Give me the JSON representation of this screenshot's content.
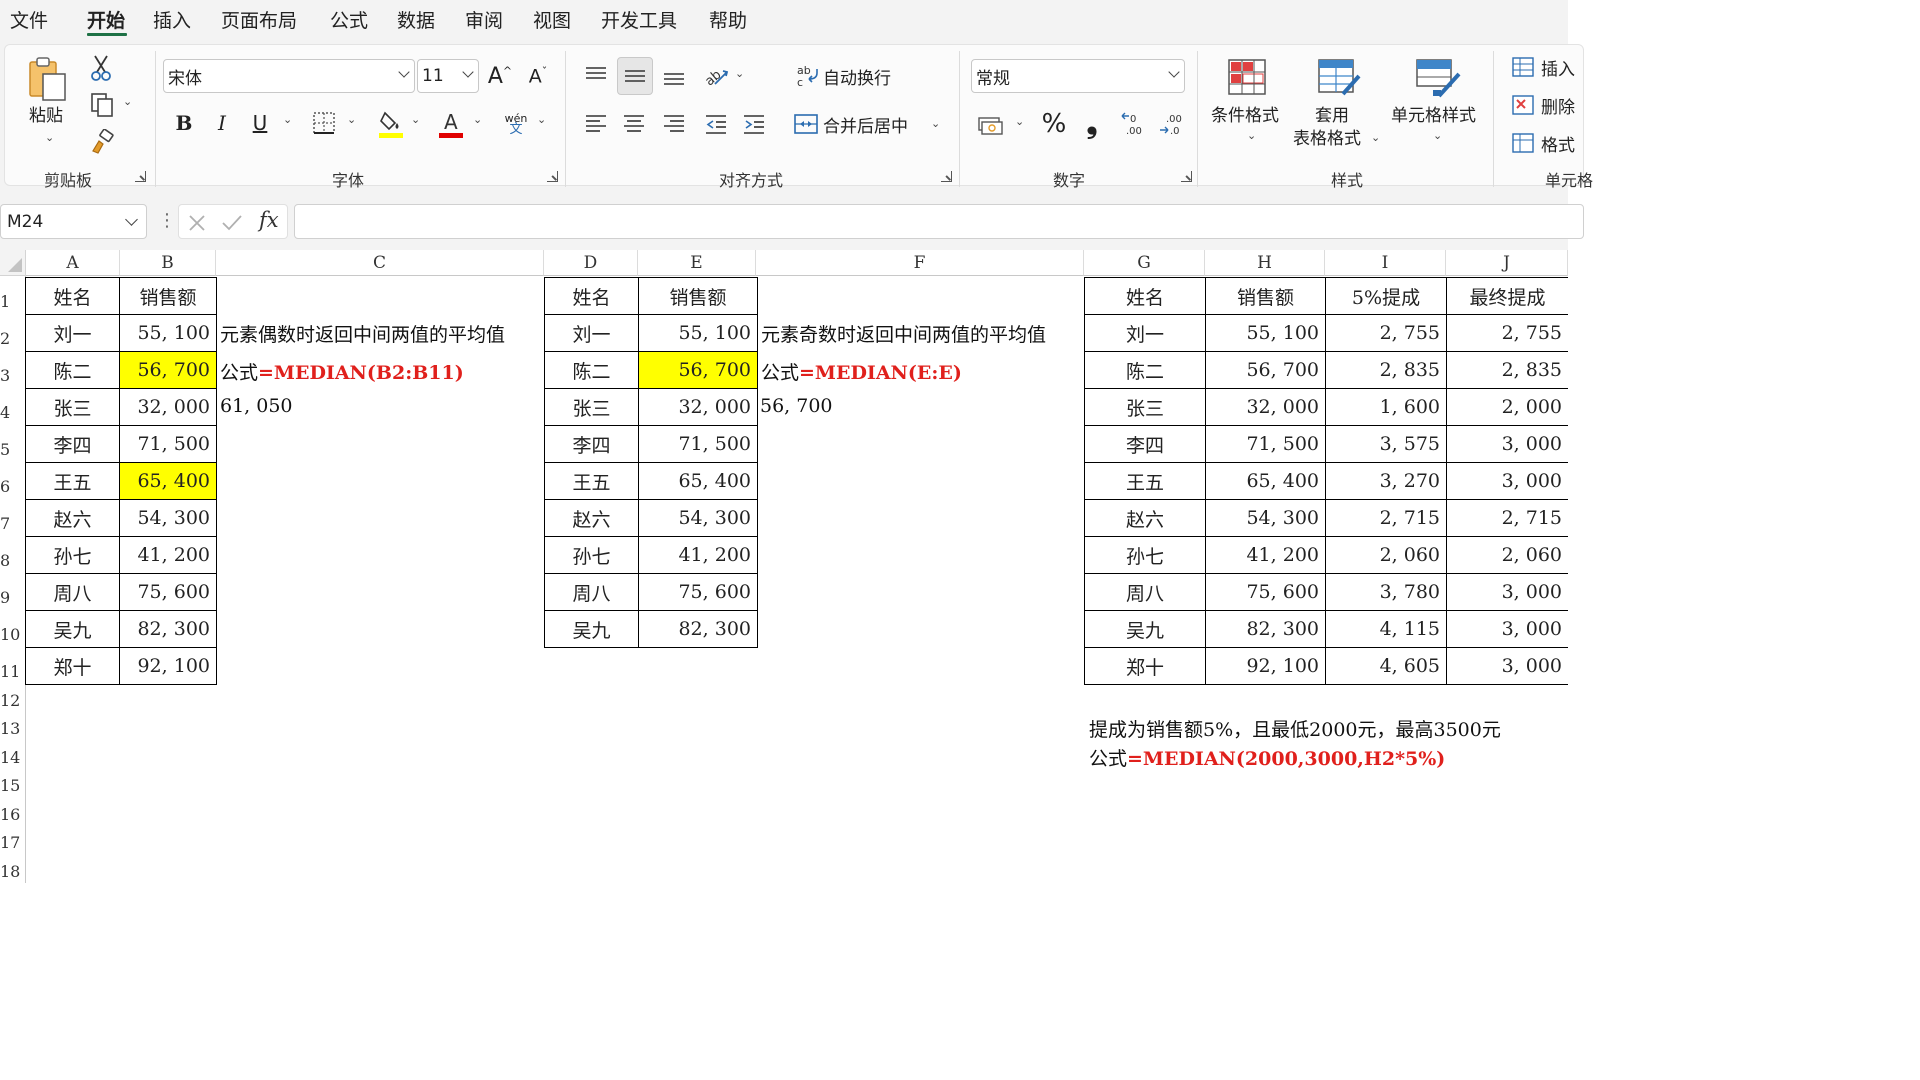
{
  "menu": [
    "文件",
    "开始",
    "插入",
    "页面布局",
    "公式",
    "数据",
    "审阅",
    "视图",
    "开发工具",
    "帮助"
  ],
  "menu_active": "开始",
  "ribbon": {
    "clipboard": {
      "paste": "粘贴",
      "label": "剪贴板"
    },
    "font": {
      "name": "宋体",
      "size": "11",
      "bold": "B",
      "italic": "I",
      "underline": "U",
      "phonetic": "wén",
      "phonetic_sub": "文",
      "label": "字体"
    },
    "alignment": {
      "wrap": "自动换行",
      "merge": "合并后居中",
      "label": "对齐方式"
    },
    "number": {
      "format": "常规",
      "percent": "%",
      "comma": "❟",
      "label": "数字"
    },
    "styles": {
      "conditional": "条件格式",
      "table_line1": "套用",
      "table_line2": "表格格式",
      "cell_styles": "单元格样式",
      "label": "样式"
    },
    "cells": {
      "insert": "插入",
      "delete": "删除",
      "format": "格式",
      "label": "单元格"
    }
  },
  "formula_bar": {
    "name_box": "M24",
    "fx": "fx",
    "value": ""
  },
  "columns": [
    "A",
    "B",
    "C",
    "D",
    "E",
    "F",
    "G",
    "H",
    "I",
    "J"
  ],
  "rows": [
    "1",
    "2",
    "3",
    "4",
    "5",
    "6",
    "7",
    "8",
    "9",
    "10",
    "11",
    "12",
    "13",
    "14",
    "15",
    "16",
    "17",
    "18"
  ],
  "table1": {
    "headers": [
      "姓名",
      "销售额"
    ],
    "rows": [
      [
        "刘一",
        "55, 100"
      ],
      [
        "陈二",
        "56, 700"
      ],
      [
        "张三",
        "32, 000"
      ],
      [
        "李四",
        "71, 500"
      ],
      [
        "王五",
        "65, 400"
      ],
      [
        "赵六",
        "54, 300"
      ],
      [
        "孙七",
        "41, 200"
      ],
      [
        "周八",
        "75, 600"
      ],
      [
        "吴九",
        "82, 300"
      ],
      [
        "郑十",
        "92, 100"
      ]
    ],
    "highlight_rows": [
      1,
      4
    ],
    "highlight_color": "#ffff00"
  },
  "note1": {
    "text": "元素偶数时返回中间两值的平均值",
    "formula_prefix": "公式",
    "formula": "=MEDIAN(B2:B11)",
    "result": "61, 050"
  },
  "table2": {
    "headers": [
      "姓名",
      "销售额"
    ],
    "rows": [
      [
        "刘一",
        "55, 100"
      ],
      [
        "陈二",
        "56, 700"
      ],
      [
        "张三",
        "32, 000"
      ],
      [
        "李四",
        "71, 500"
      ],
      [
        "王五",
        "65, 400"
      ],
      [
        "赵六",
        "54, 300"
      ],
      [
        "孙七",
        "41, 200"
      ],
      [
        "周八",
        "75, 600"
      ],
      [
        "吴九",
        "82, 300"
      ]
    ],
    "highlight_rows": [
      1
    ]
  },
  "note2": {
    "text": "元素奇数时返回中间两值的平均值",
    "formula_prefix": "公式",
    "formula": "=MEDIAN(E:E)",
    "result": "56, 700"
  },
  "table3": {
    "headers": [
      "姓名",
      "销售额",
      "5%提成",
      "最终提成"
    ],
    "rows": [
      [
        "刘一",
        "55, 100",
        "2, 755",
        "2, 755"
      ],
      [
        "陈二",
        "56, 700",
        "2, 835",
        "2, 835"
      ],
      [
        "张三",
        "32, 000",
        "1, 600",
        "2, 000"
      ],
      [
        "李四",
        "71, 500",
        "3, 575",
        "3, 000"
      ],
      [
        "王五",
        "65, 400",
        "3, 270",
        "3, 000"
      ],
      [
        "赵六",
        "54, 300",
        "2, 715",
        "2, 715"
      ],
      [
        "孙七",
        "41, 200",
        "2, 060",
        "2, 060"
      ],
      [
        "周八",
        "75, 600",
        "3, 780",
        "3, 000"
      ],
      [
        "吴九",
        "82, 300",
        "4, 115",
        "3, 000"
      ],
      [
        "郑十",
        "92, 100",
        "4, 605",
        "3, 000"
      ]
    ]
  },
  "note3": {
    "text": "提成为销售额5%，且最低2000元，最高3500元",
    "formula_prefix": "公式",
    "formula": "=MEDIAN(2000,3000,H2*5%)"
  },
  "colors": {
    "accent": "#1e7145",
    "formula_red": "#e0201c",
    "grid_border": "#000000"
  }
}
